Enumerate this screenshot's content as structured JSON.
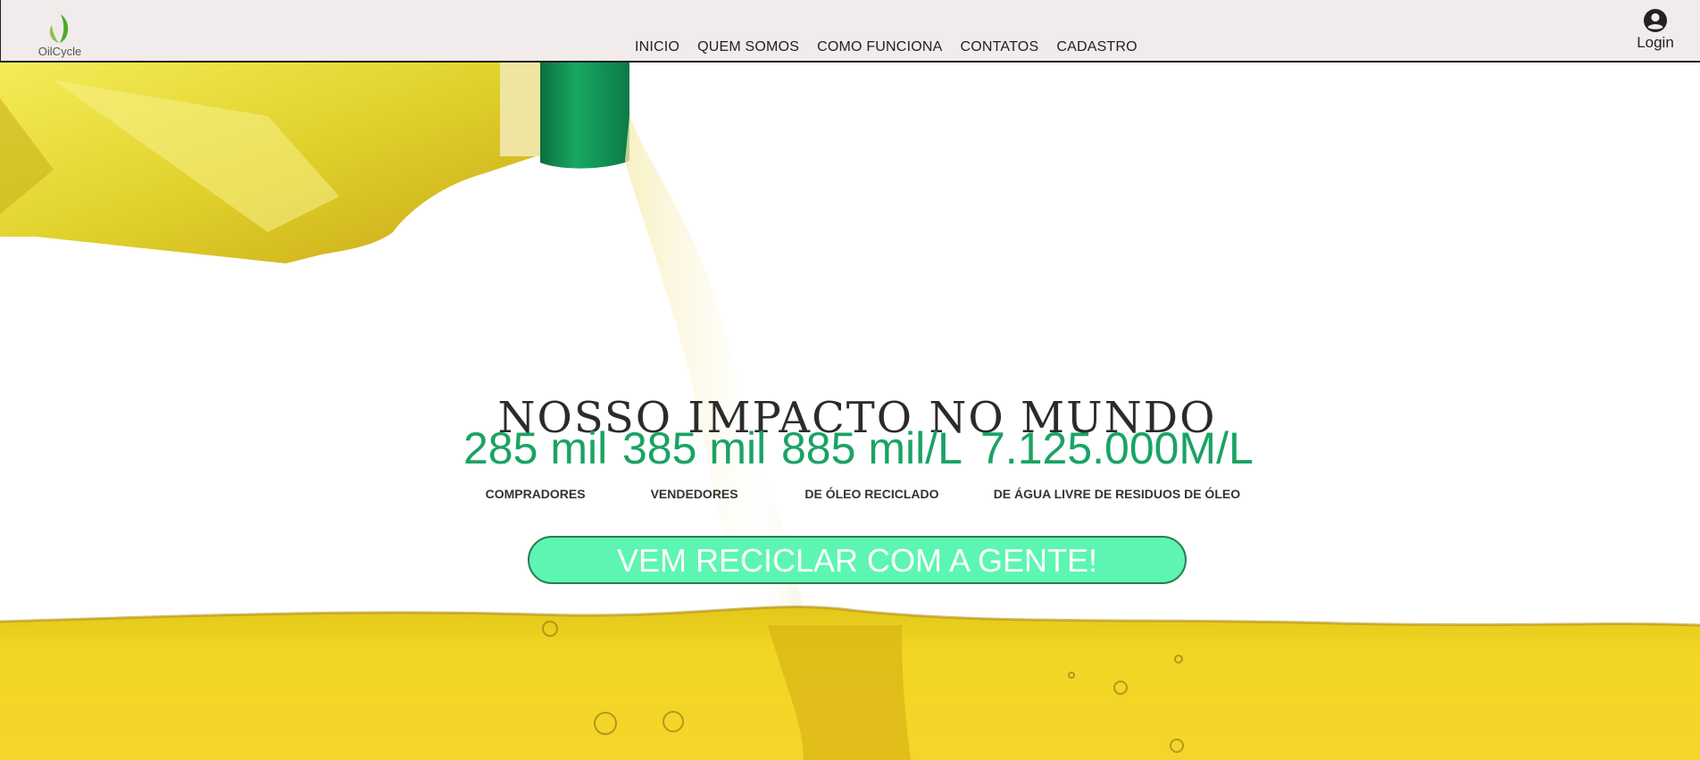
{
  "header": {
    "brand_name": "OilCycle",
    "nav": [
      "INICIO",
      "QUEM SOMOS",
      "COMO FUNCIONA",
      "CONTATOS",
      "CADASTRO"
    ],
    "login_label": "Login"
  },
  "hero": {
    "title": "NOSSO IMPACTO NO MUNDO",
    "stats": [
      {
        "value": "285 mil",
        "label": "COMPRADORES"
      },
      {
        "value": "385 mil",
        "label": "VENDEDORES"
      },
      {
        "value": "885 mil/L",
        "label": "DE ÓLEO RECICLADO"
      },
      {
        "value": "7.125.000M/L",
        "label": "DE ÁGUA LIVRE DE RESIDUOS DE ÓLEO"
      }
    ],
    "cta_label": "VEM RECICLAR COM A GENTE!"
  },
  "colors": {
    "accent_green": "#1aa364",
    "cta_bg": "#5cf6b2",
    "oil_yellow": "#f0d21a",
    "bottle_cap": "#0f8a4f",
    "navbar_bg": "#f1ebeb"
  }
}
